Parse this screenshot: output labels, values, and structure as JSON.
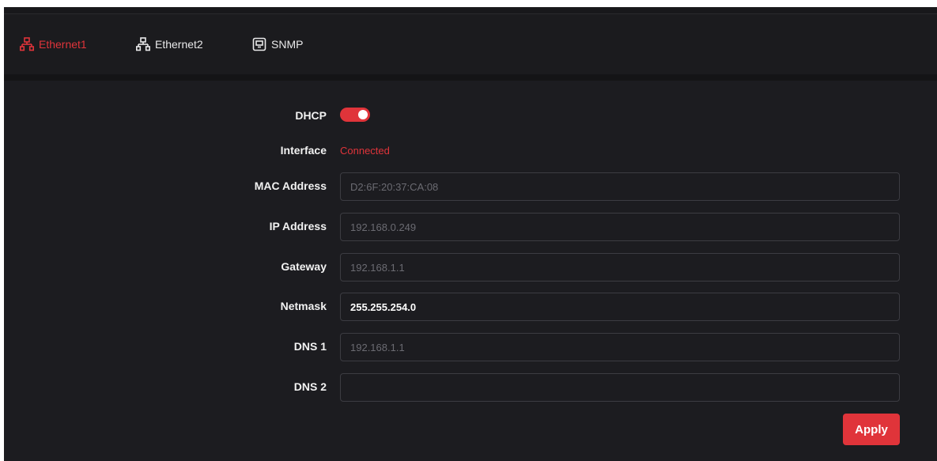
{
  "tabs": [
    {
      "label": "Ethernet1",
      "icon": "network-icon",
      "active": true
    },
    {
      "label": "Ethernet2",
      "icon": "network-icon",
      "active": false
    },
    {
      "label": "SNMP",
      "icon": "snmp-icon",
      "active": false
    }
  ],
  "form": {
    "dhcp": {
      "label": "DHCP",
      "enabled": true
    },
    "interface": {
      "label": "Interface",
      "status": "Connected"
    },
    "mac": {
      "label": "MAC Address",
      "value": "D2:6F:20:37:CA:08"
    },
    "ip": {
      "label": "IP Address",
      "value": "192.168.0.249"
    },
    "gateway": {
      "label": "Gateway",
      "value": "192.168.1.1"
    },
    "netmask": {
      "label": "Netmask",
      "value": "255.255.254.0"
    },
    "dns1": {
      "label": "DNS 1",
      "value": "192.168.1.1"
    },
    "dns2": {
      "label": "DNS 2",
      "value": ""
    }
  },
  "apply_label": "Apply",
  "colors": {
    "accent": "#e0343a",
    "background": "#1c1c20"
  }
}
